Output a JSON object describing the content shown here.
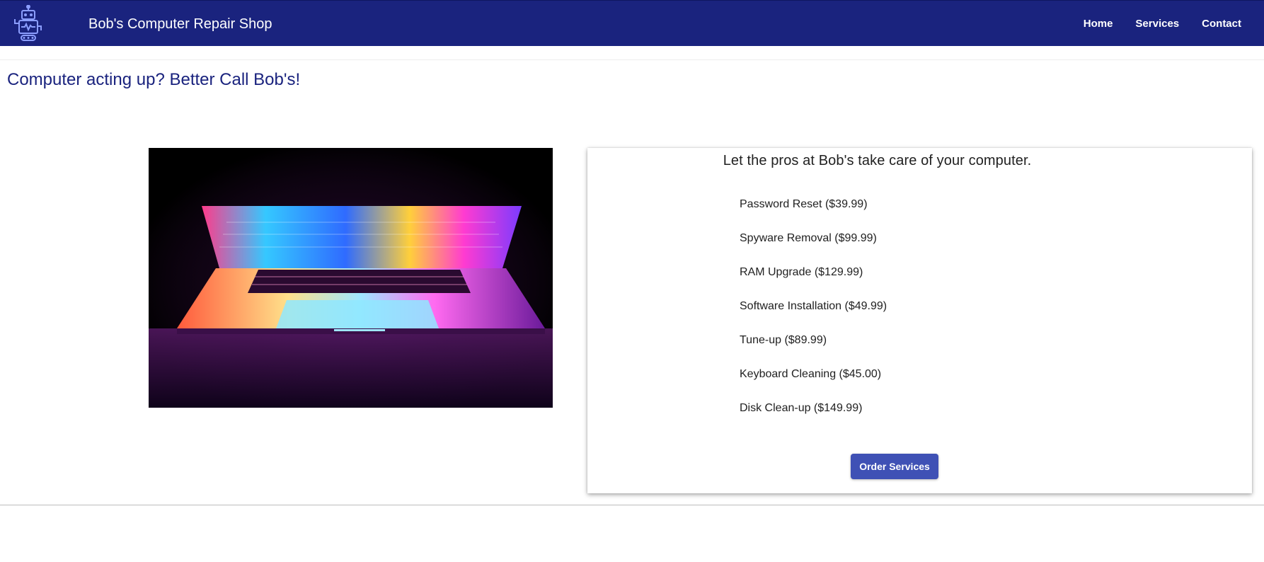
{
  "header": {
    "brand": "Bob's Computer Repair Shop",
    "logo_icon": "robot-icon",
    "nav": [
      {
        "label": "Home"
      },
      {
        "label": "Services"
      },
      {
        "label": "Contact"
      }
    ],
    "bg_color": "#1a237e"
  },
  "main": {
    "headline": "Computer acting up? Better Call Bob's!",
    "hero_image": "laptop-photo",
    "card": {
      "title": "Let the pros at Bob's take care of your computer.",
      "services": [
        "Password Reset ($39.99)",
        "Spyware Removal ($99.99)",
        "RAM Upgrade ($129.99)",
        "Software Installation ($49.99)",
        "Tune-up ($89.99)",
        "Keyboard Cleaning ($45.00)",
        "Disk Clean-up ($149.99)"
      ],
      "order_button": "Order Services",
      "button_color": "#3f51b5"
    }
  }
}
